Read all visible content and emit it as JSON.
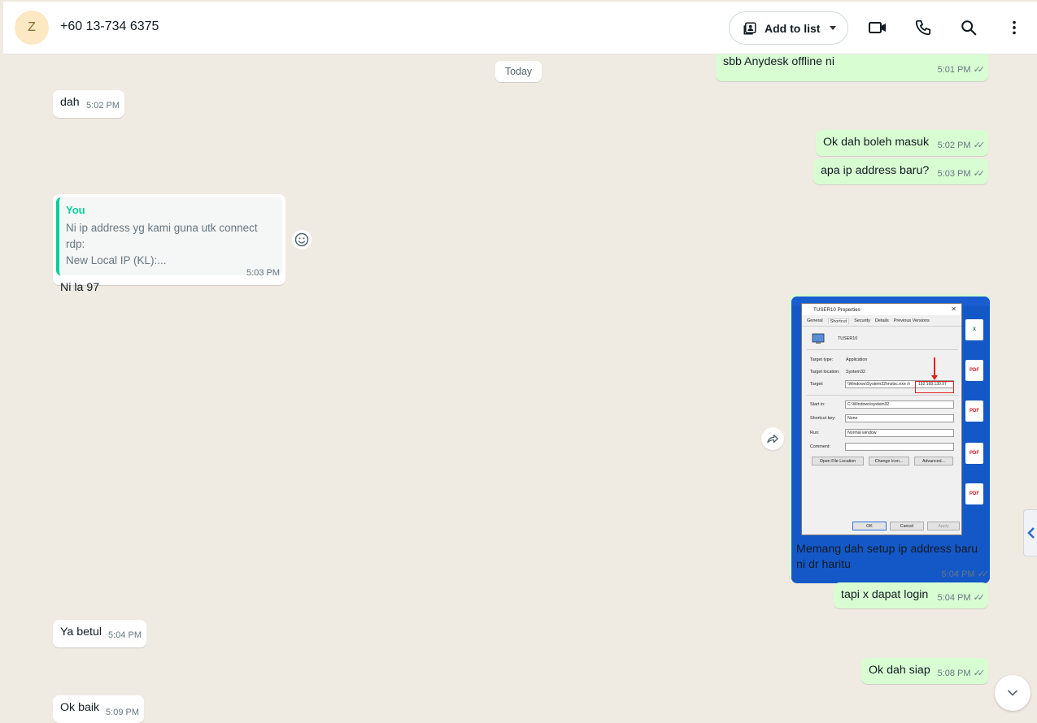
{
  "header": {
    "avatar_letter": "Z",
    "contact": "+60 13-734 6375",
    "add_to_list": "Add to list"
  },
  "chat": {
    "date_divider": "Today",
    "messages": [
      {
        "dir": "out",
        "text": "sbb Anydesk offline ni",
        "time": "5:01 PM"
      },
      {
        "dir": "in",
        "text": "dah",
        "time": "5:02 PM"
      },
      {
        "dir": "out",
        "text": "Ok dah boleh masuk",
        "time": "5:02 PM"
      },
      {
        "dir": "out",
        "text": "apa ip address baru?",
        "time": "5:03 PM"
      },
      {
        "dir": "in",
        "quote_author": "You",
        "quote_line1": "Ni ip address yg kami guna utk connect rdp:",
        "quote_line2": "New Local IP (KL):...",
        "text": "Ni la 97",
        "time": "5:03 PM"
      },
      {
        "dir": "out",
        "caption_line1": "Memang dah setup ip address baru",
        "caption_line2": "ni dr haritu",
        "time": "5:04 PM"
      },
      {
        "dir": "out",
        "text": "tapi x dapat login",
        "time": "5:04 PM"
      },
      {
        "dir": "in",
        "text": "Ya betul",
        "time": "5:04 PM"
      },
      {
        "dir": "out",
        "text": "Ok dah siap",
        "time": "5:08 PM"
      },
      {
        "dir": "in",
        "text": "Ok baik",
        "time": "5:09 PM"
      }
    ],
    "ticks": "✓✓"
  },
  "screenshot": {
    "dialog_title": "TUSER10 Properties",
    "tabs": [
      "General",
      "Shortcut",
      "Security",
      "Details",
      "Previous Versions"
    ],
    "name": "TUSER10",
    "target_type_label": "Target type:",
    "target_type": "Application",
    "target_location_label": "Target location:",
    "target_location": "System32",
    "target_label": "Target:",
    "target": "\\Windows\\System32\\mstsc.exe /v",
    "target_ip": "192.168.130.97",
    "start_in_label": "Start in:",
    "start_in": "C:\\Windows\\system32",
    "shortcut_key_label": "Shortcut key:",
    "shortcut_key": "None",
    "run_label": "Run:",
    "run": "Normal window",
    "comment_label": "Comment:",
    "btn_open": "Open File Location",
    "btn_change": "Change Icon...",
    "btn_advanced": "Advanced...",
    "btn_ok": "OK",
    "btn_cancel": "Cancel",
    "btn_apply": "Apply",
    "pdf": "PDF"
  }
}
